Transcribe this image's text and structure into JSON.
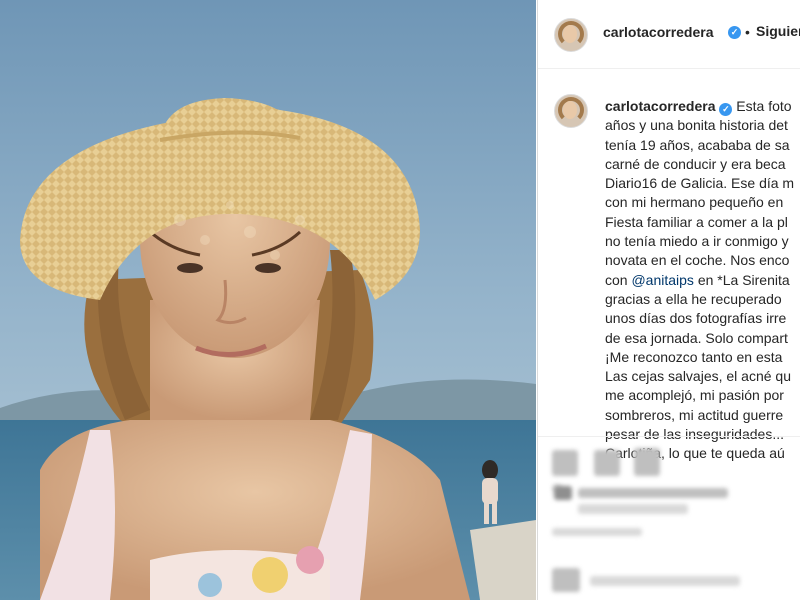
{
  "post": {
    "username": "carlotacorredera",
    "verified_badge": "✓",
    "separator": "•",
    "follow_label": "Siguien"
  },
  "caption": {
    "username": "carlotacorredera",
    "first_line_text": "Esta foto",
    "lines": [
      "años y una bonita historia det",
      "tenía 19 años, acababa de sa",
      "carné de conducir y era beca",
      "Diario16 de Galicia. Ese día m",
      "con mi hermano pequeño en",
      "Fiesta familiar a comer a la pl",
      "no tenía miedo a ir conmigo y",
      "novata en el coche. Nos enco"
    ],
    "mention_prefix": "con ",
    "mention": "@anitaips",
    "mention_suffix": " en *La Sirenita",
    "lines_after": [
      "gracias a ella he recuperado",
      "unos días dos fotografías irre",
      "de esa jornada. Solo compart",
      "¡Me reconozco tanto en esta",
      "Las cejas salvajes, el acné qu",
      "me acomplejó, mi pasión por",
      "sombreros, mi actitud guerre",
      "pesar de las inseguridades...",
      "Carlotiña, lo que te queda aú"
    ]
  },
  "icons": {
    "photo": "beach-portrait-photo",
    "avatar": "profile-avatar",
    "verified": "verified-badge-icon",
    "blurred": "pixelated-icon"
  },
  "colors": {
    "text": "#262626",
    "verified": "#3897f0",
    "mention": "#00376b",
    "border": "#dbdbdb"
  }
}
